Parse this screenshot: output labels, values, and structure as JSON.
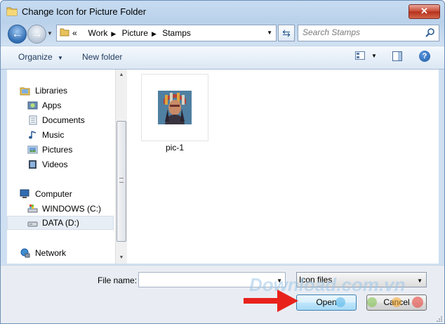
{
  "window": {
    "title": "Change Icon for Picture Folder",
    "close_glyph": "✕"
  },
  "nav": {
    "back_glyph": "←",
    "forward_glyph": "→",
    "breadcrumb_prefix": "«",
    "breadcrumbs": [
      "Work",
      "Picture",
      "Stamps"
    ],
    "search_placeholder": "Search Stamps"
  },
  "toolbar": {
    "organize_label": "Organize",
    "new_folder_label": "New folder",
    "help_glyph": "?"
  },
  "sidebar": {
    "items": [
      {
        "label": "Libraries",
        "icon": "libraries-icon"
      },
      {
        "label": "Apps",
        "icon": "apps-icon"
      },
      {
        "label": "Documents",
        "icon": "documents-icon"
      },
      {
        "label": "Music",
        "icon": "music-icon"
      },
      {
        "label": "Pictures",
        "icon": "pictures-icon"
      },
      {
        "label": "Videos",
        "icon": "videos-icon"
      },
      {
        "label": "Computer",
        "icon": "computer-icon"
      },
      {
        "label": "WINDOWS (C:)",
        "icon": "drive-c-icon"
      },
      {
        "label": "DATA (D:)",
        "icon": "drive-d-icon",
        "selected": true
      },
      {
        "label": "Network",
        "icon": "network-icon"
      }
    ]
  },
  "files": [
    {
      "name": "pic-1"
    }
  ],
  "footer": {
    "file_name_label": "File name:",
    "file_name_value": "",
    "file_type_value": "Icon files",
    "open_label": "Open",
    "cancel_label": "Cancel"
  },
  "watermark": {
    "text": "Download.com.vn"
  },
  "colors": {
    "accent": "#3c7fb1",
    "arrow": "#e8221b",
    "selection": "#e8eef6",
    "watermark_dots": [
      "#4fb3e8",
      "#7ac143",
      "#f5a623",
      "#e8453c"
    ]
  }
}
